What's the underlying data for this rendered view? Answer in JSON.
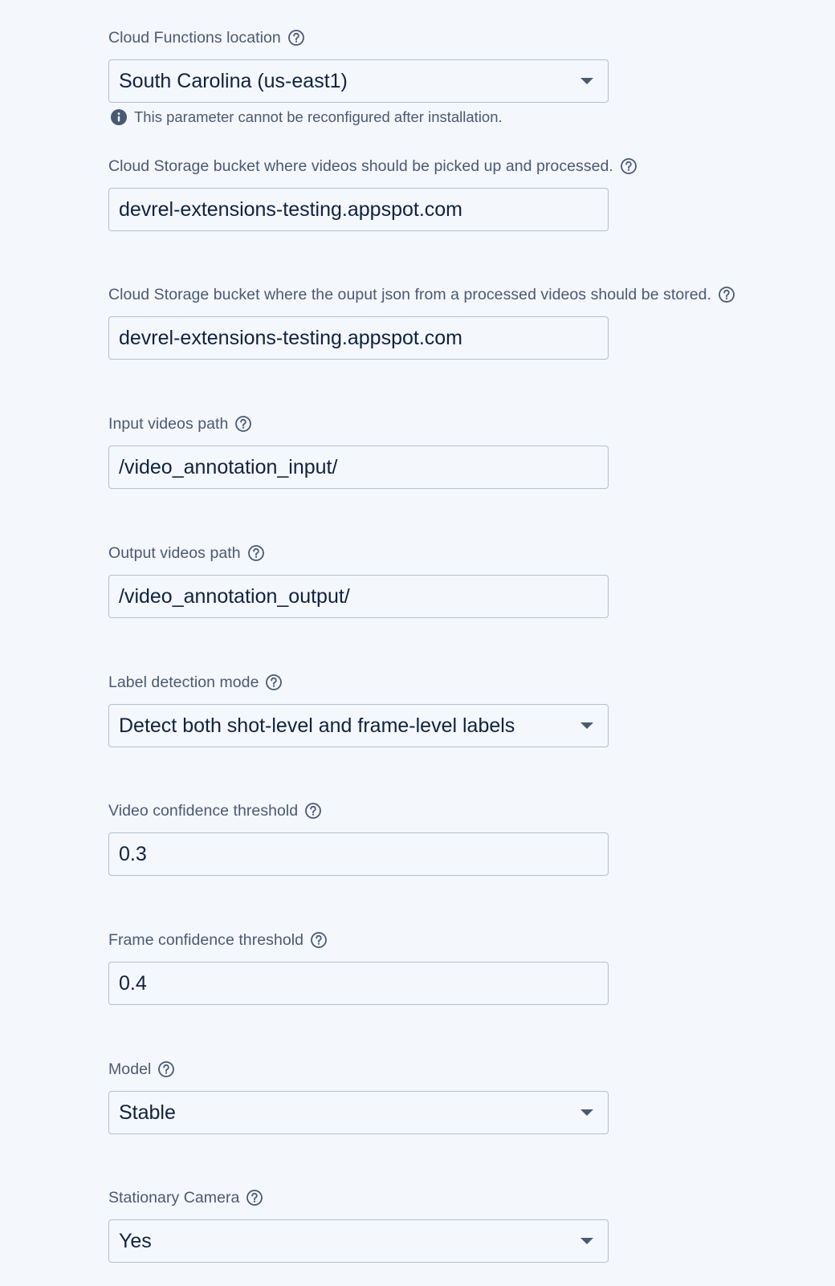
{
  "fields": [
    {
      "id": "cloud-functions-location",
      "label": "Cloud Functions location",
      "type": "select",
      "value": "South Carolina (us-east1)",
      "note": "This parameter cannot be reconfigured after installation."
    },
    {
      "id": "input-bucket",
      "label": "Cloud Storage bucket where videos should be picked up and processed.",
      "type": "text",
      "value": "devrel-extensions-testing.appspot.com"
    },
    {
      "id": "output-bucket",
      "label": "Cloud Storage bucket where the ouput json from a processed videos should be stored.",
      "type": "text",
      "value": "devrel-extensions-testing.appspot.com"
    },
    {
      "id": "input-videos-path",
      "label": "Input videos path",
      "type": "text",
      "value": "/video_annotation_input/"
    },
    {
      "id": "output-videos-path",
      "label": "Output videos path",
      "type": "text",
      "value": "/video_annotation_output/"
    },
    {
      "id": "label-detection-mode",
      "label": "Label detection mode",
      "type": "select",
      "value": "Detect both shot-level and frame-level labels"
    },
    {
      "id": "video-confidence-threshold",
      "label": "Video confidence threshold",
      "type": "text",
      "value": "0.3"
    },
    {
      "id": "frame-confidence-threshold",
      "label": "Frame confidence threshold",
      "type": "text",
      "value": "0.4"
    },
    {
      "id": "model",
      "label": "Model",
      "type": "select",
      "value": "Stable"
    },
    {
      "id": "stationary-camera",
      "label": "Stationary Camera",
      "type": "select",
      "value": "Yes"
    }
  ],
  "icons": {
    "help": "help-circle-icon",
    "info": "info-icon",
    "dropdown": "dropdown-arrow-icon"
  },
  "colors": {
    "background": "#f4f7fc",
    "label_text": "#4a5a72",
    "value_text": "#0f2240",
    "border": "#b5bfcf"
  }
}
